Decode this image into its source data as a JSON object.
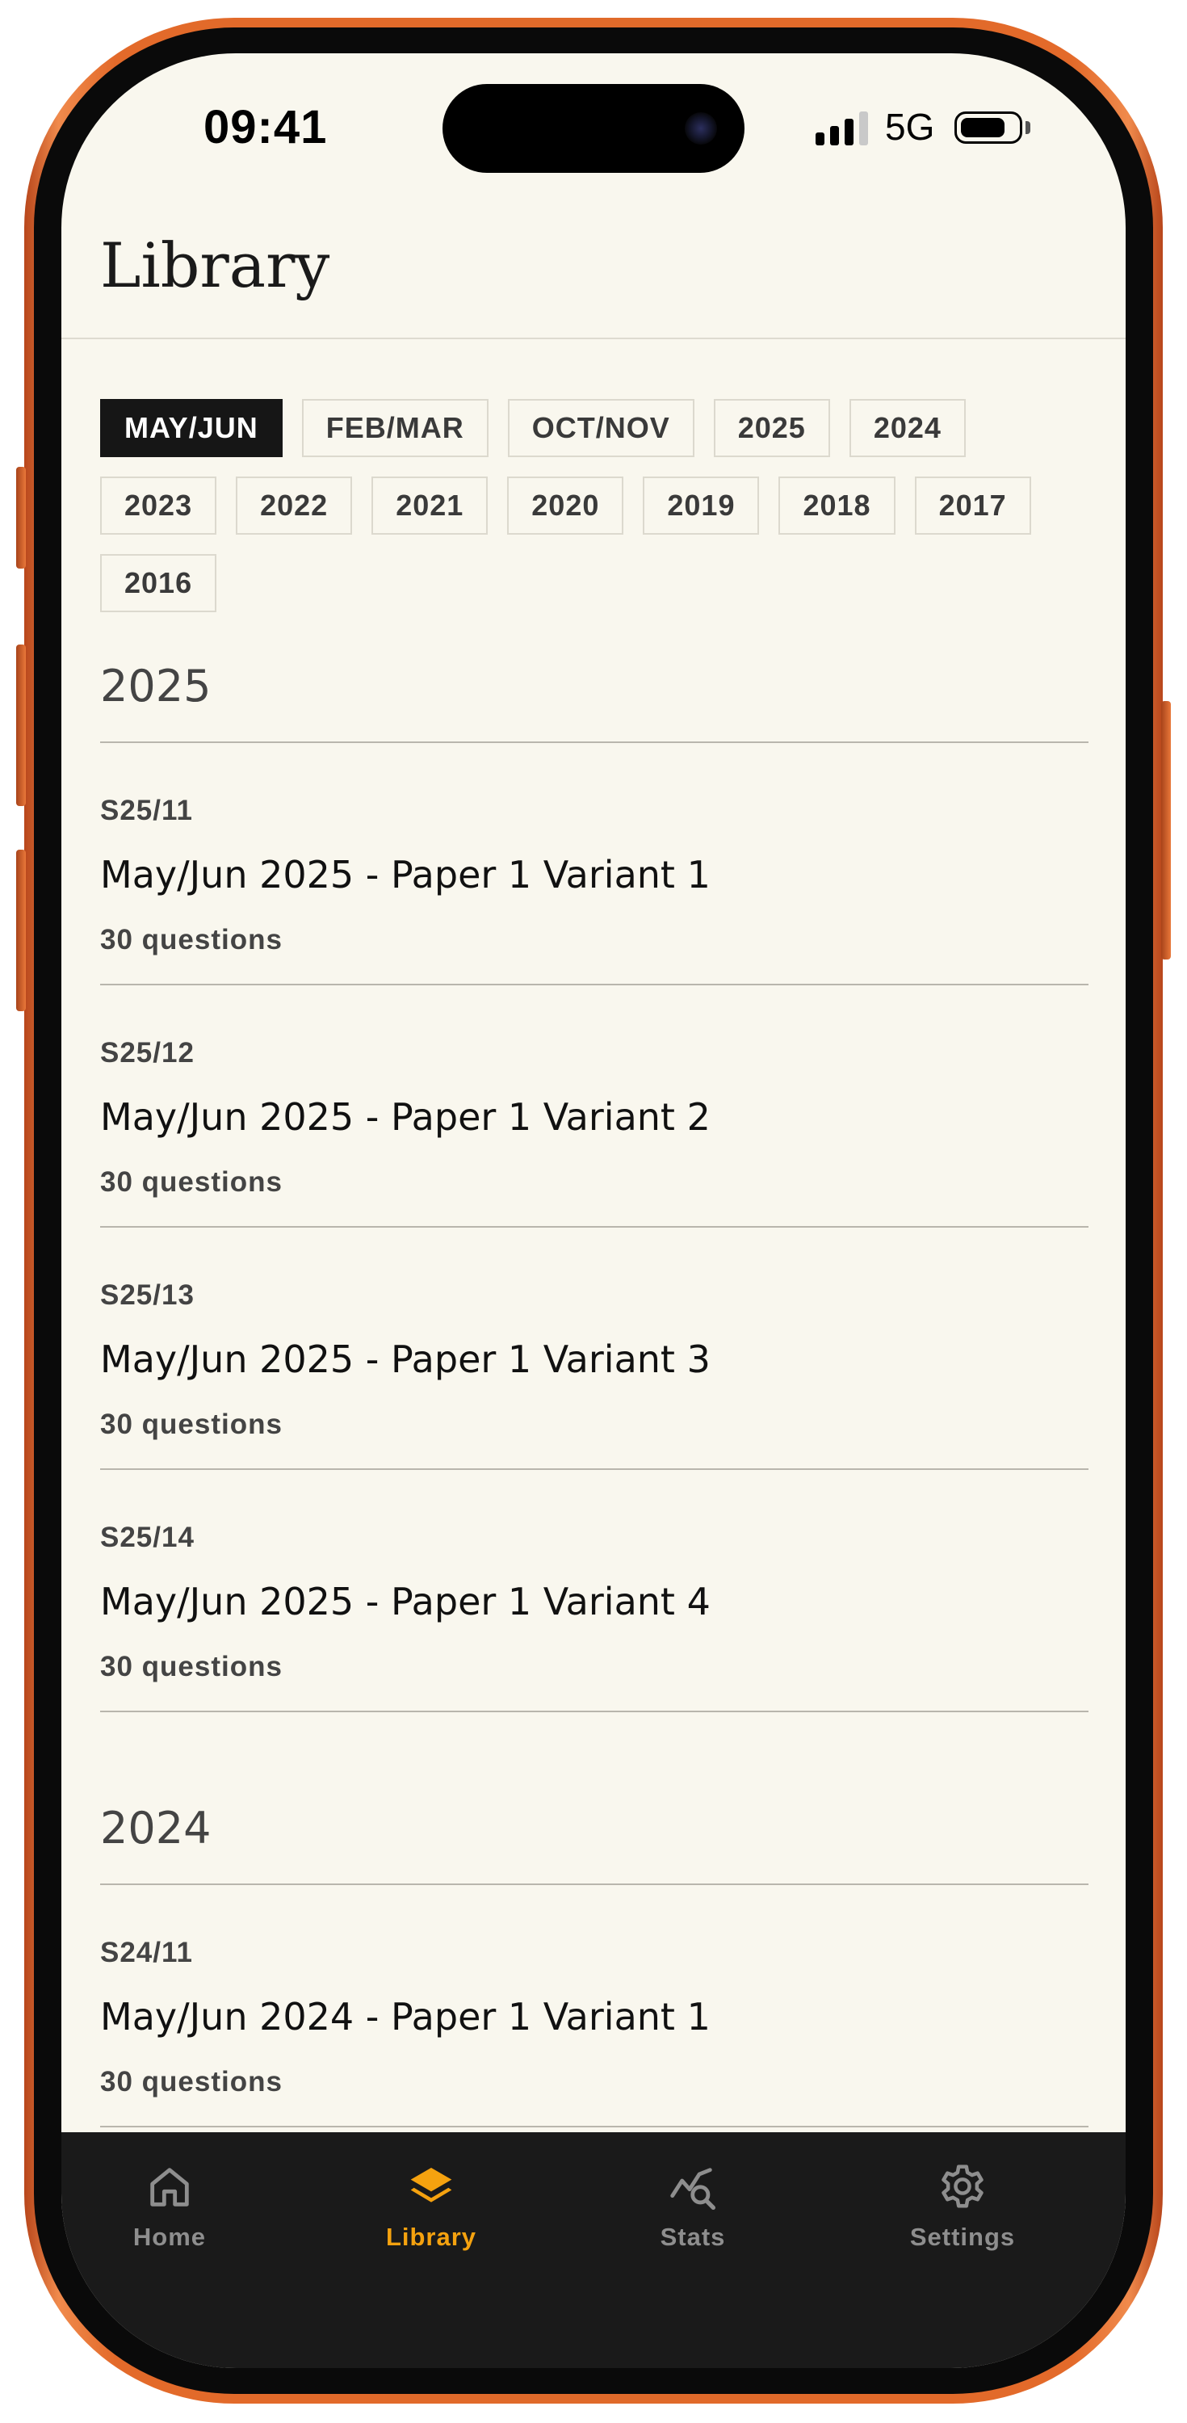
{
  "status_bar": {
    "time": "09:41",
    "network": "5G",
    "signal_bars_active": 3,
    "battery_level": 0.8
  },
  "header": {
    "title": "Library"
  },
  "filters": [
    {
      "label": "MAY/JUN",
      "active": true
    },
    {
      "label": "FEB/MAR",
      "active": false
    },
    {
      "label": "OCT/NOV",
      "active": false
    },
    {
      "label": "2025",
      "active": false
    },
    {
      "label": "2024",
      "active": false
    },
    {
      "label": "2023",
      "active": false
    },
    {
      "label": "2022",
      "active": false
    },
    {
      "label": "2021",
      "active": false
    },
    {
      "label": "2020",
      "active": false
    },
    {
      "label": "2019",
      "active": false
    },
    {
      "label": "2018",
      "active": false
    },
    {
      "label": "2017",
      "active": false
    },
    {
      "label": "2016",
      "active": false
    }
  ],
  "sections": [
    {
      "year": "2025",
      "papers": [
        {
          "code": "S25/11",
          "title": "May/Jun 2025 - Paper 1 Variant 1",
          "count": "30 questions"
        },
        {
          "code": "S25/12",
          "title": "May/Jun 2025 - Paper 1 Variant 2",
          "count": "30 questions"
        },
        {
          "code": "S25/13",
          "title": "May/Jun 2025 - Paper 1 Variant 3",
          "count": "30 questions"
        },
        {
          "code": "S25/14",
          "title": "May/Jun 2025 - Paper 1 Variant 4",
          "count": "30 questions"
        }
      ]
    },
    {
      "year": "2024",
      "papers": [
        {
          "code": "S24/11",
          "title": "May/Jun 2024 - Paper 1 Variant 1",
          "count": "30 questions"
        }
      ]
    }
  ],
  "tab_bar": {
    "tabs": [
      {
        "label": "Home",
        "icon": "home-icon",
        "active": false
      },
      {
        "label": "Library",
        "icon": "layers-icon",
        "active": true
      },
      {
        "label": "Stats",
        "icon": "stats-search-icon",
        "active": false
      },
      {
        "label": "Settings",
        "icon": "gear-icon",
        "active": false
      }
    ]
  },
  "colors": {
    "background": "#f9f7ee",
    "accent": "#f5a20f",
    "tab_bar": "#1a1a1a",
    "chip_active": "#161616",
    "phone_frame": "#e36a2a"
  }
}
